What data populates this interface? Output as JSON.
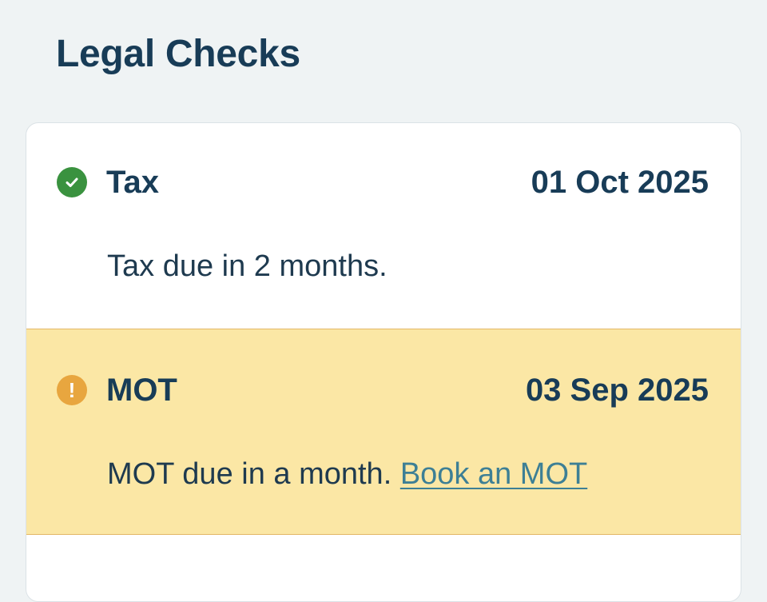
{
  "page": {
    "title": "Legal Checks"
  },
  "checks": [
    {
      "title": "Tax",
      "date": "01 Oct 2025",
      "status_icon": "check-circle-icon",
      "status_color": "#3a923f",
      "description": "Tax due in 2 months."
    },
    {
      "title": "MOT",
      "date": "03 Sep 2025",
      "status_icon": "warning-circle-icon",
      "status_glyph": "!",
      "status_color": "#e8a63f",
      "highlight_color": "#fbe7a5",
      "description": "MOT due in a month.",
      "action_link": "Book an MOT"
    }
  ]
}
